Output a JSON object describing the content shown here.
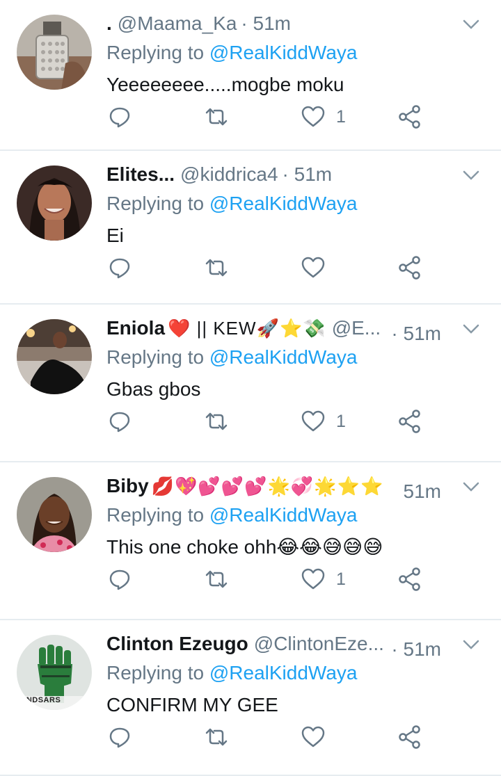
{
  "colors": {
    "accent": "#1da1f2",
    "muted": "#657786",
    "text": "#14171a",
    "divider": "#e6ecf0"
  },
  "tweets": [
    {
      "name": ".",
      "handle": "@Maama_Ka",
      "time": "· 51m",
      "replying_prefix": "Replying to ",
      "replying_to": "@RealKiddWaya",
      "text": "Yeeeeeeee.....mogbe moku",
      "like_count": "1",
      "avatar_icon": "perfume-bottle-avatar"
    },
    {
      "name": "Elites...",
      "handle": "@kiddrica4",
      "time": "· 51m",
      "replying_prefix": "Replying to ",
      "replying_to": "@RealKiddWaya",
      "text": "Ei",
      "like_count": "",
      "avatar_icon": "woman-portrait-avatar"
    },
    {
      "name": "Eniola",
      "name_emojis": "❤️ || KEW🚀⭐💸",
      "handle": "@E...",
      "time": "· 51m",
      "replying_prefix": "Replying to ",
      "replying_to": "@RealKiddWaya",
      "text": "Gbas gbos",
      "like_count": "1",
      "avatar_icon": "woman-on-sofa-avatar"
    },
    {
      "name": "Biby",
      "name_emojis": "💋💖💕💕💕🌟💞🌟⭐⭐",
      "handle": "",
      "time": "51m",
      "replying_prefix": "Replying to ",
      "replying_to": "@RealKiddWaya",
      "text": "This one choke ohh😂😂😅😅😅",
      "like_count": "1",
      "avatar_icon": "smiling-woman-avatar"
    },
    {
      "name": "Clinton Ezeugo",
      "handle": "@ClintonEze...",
      "time": "· 51m",
      "replying_prefix": "Replying to ",
      "replying_to": "@RealKiddWaya",
      "text": "CONFIRM MY GEE",
      "like_count": "",
      "avatar_icon": "endsars-fist-avatar",
      "avatar_text": "ENDSARS"
    }
  ]
}
